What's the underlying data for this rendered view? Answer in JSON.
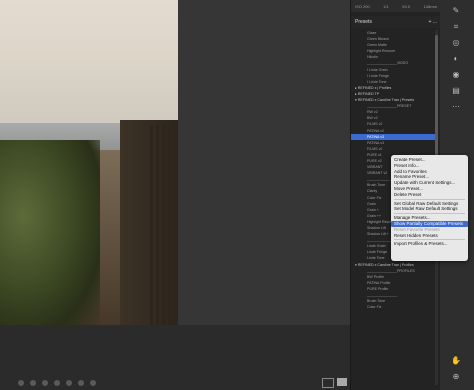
{
  "photo": {
    "description_tags": [
      "sky",
      "sea",
      "sand-path",
      "dune-grass",
      "fence"
    ]
  },
  "filmstrip": {
    "dots": 7
  },
  "panel": {
    "info_bar": {
      "iso": "ISO 200",
      "shutter": "1/1",
      "aperture": "f/4.0",
      "focal": "148mm"
    },
    "presets_title": "Presets",
    "presets_actions": [
      "+",
      "..."
    ],
    "items": [
      {
        "label": "Glaze",
        "kind": "item"
      },
      {
        "label": "Green Bleach",
        "kind": "item"
      },
      {
        "label": "Green Matte",
        "kind": "item"
      },
      {
        "label": "Highlight Recover",
        "kind": "item"
      },
      {
        "label": "Hikotin",
        "kind": "item"
      },
      {
        "label": "_______________VIDEO",
        "kind": "item"
      },
      {
        "label": "I Linde Grain",
        "kind": "item"
      },
      {
        "label": "I Linde Fringe",
        "kind": "item"
      },
      {
        "label": "I Linde Tone",
        "kind": "item"
      },
      {
        "label": "▸ REFINED x | Profiles",
        "kind": "group"
      },
      {
        "label": "▸ REFINED TP",
        "kind": "group"
      },
      {
        "label": "▾ REFINED x Caroline Tran | Presets",
        "kind": "group"
      },
      {
        "label": "_______________PRESET",
        "kind": "item"
      },
      {
        "label": "RW v2",
        "kind": "item"
      },
      {
        "label": "BW v2",
        "kind": "item"
      },
      {
        "label": "FILMS v2",
        "kind": "item"
      },
      {
        "label": "PATINA v2",
        "kind": "item"
      },
      {
        "label": "PATINA v3",
        "kind": "selected"
      },
      {
        "label": "PATINA v3",
        "kind": "item"
      },
      {
        "label": "FILMS v2",
        "kind": "item"
      },
      {
        "label": "PURE v1",
        "kind": "item"
      },
      {
        "label": "PURE v2",
        "kind": "item"
      },
      {
        "label": "VIBRANT",
        "kind": "item"
      },
      {
        "label": "VIBRANT v2",
        "kind": "item"
      },
      {
        "label": "_______________",
        "kind": "item"
      },
      {
        "label": "Brush Tone",
        "kind": "item"
      },
      {
        "label": "Clarity",
        "kind": "item"
      },
      {
        "label": "Color Fix",
        "kind": "item"
      },
      {
        "label": "Grain",
        "kind": "item"
      },
      {
        "label": "Grain +",
        "kind": "item"
      },
      {
        "label": "Grain ++",
        "kind": "item"
      },
      {
        "label": "Highlight Recover",
        "kind": "item"
      },
      {
        "label": "Shadow Lift",
        "kind": "item"
      },
      {
        "label": "Shadow Lift +",
        "kind": "item"
      },
      {
        "label": "_______________VIDEO",
        "kind": "item"
      },
      {
        "label": "Linde Grain",
        "kind": "item"
      },
      {
        "label": "Linde Fringe",
        "kind": "item"
      },
      {
        "label": "Linde Tone",
        "kind": "item"
      },
      {
        "label": "▾ REFINED x Caroline Tran | Profiles",
        "kind": "group"
      },
      {
        "label": "_______________PROFILES",
        "kind": "item"
      },
      {
        "label": "BW Profile",
        "kind": "item"
      },
      {
        "label": "PATINA Profile",
        "kind": "item"
      },
      {
        "label": "PURE Profile",
        "kind": "item"
      },
      {
        "label": "_______________",
        "kind": "item"
      },
      {
        "label": "Brush Tone",
        "kind": "item"
      },
      {
        "label": "Color Fix",
        "kind": "item"
      }
    ]
  },
  "context_menu": {
    "items": [
      {
        "label": "Create Preset...",
        "state": "normal"
      },
      {
        "label": "Preset Info...",
        "state": "normal"
      },
      {
        "label": "Add to Favorites",
        "state": "normal"
      },
      {
        "label": "Rename Preset...",
        "state": "normal"
      },
      {
        "label": "Update with Current Settings...",
        "state": "normal"
      },
      {
        "label": "Move Preset...",
        "state": "normal"
      },
      {
        "label": "Delete Preset",
        "state": "normal"
      },
      {
        "label": "sep",
        "state": "sep"
      },
      {
        "label": "Set Global Raw Default Settings",
        "state": "normal"
      },
      {
        "label": "Set Model Raw Default Settings",
        "state": "normal"
      },
      {
        "label": "sep",
        "state": "sep"
      },
      {
        "label": "Manage Presets...",
        "state": "normal"
      },
      {
        "label": "Show Partially Compatible Presets",
        "state": "highlight"
      },
      {
        "label": "Reset Favorite Presets",
        "state": "disabled"
      },
      {
        "label": "Reset Hidden Presets",
        "state": "normal"
      },
      {
        "label": "sep",
        "state": "sep"
      },
      {
        "label": "Import Profiles & Presets...",
        "state": "normal"
      }
    ]
  },
  "toolstrip": {
    "icons": [
      "edit-icon",
      "crop-icon",
      "heal-icon",
      "mask-icon",
      "redeye-icon",
      "presets-icon",
      "more-icon",
      "hand-icon",
      "zoom-icon"
    ]
  },
  "colors": {
    "accent": "#3b6ad1"
  }
}
